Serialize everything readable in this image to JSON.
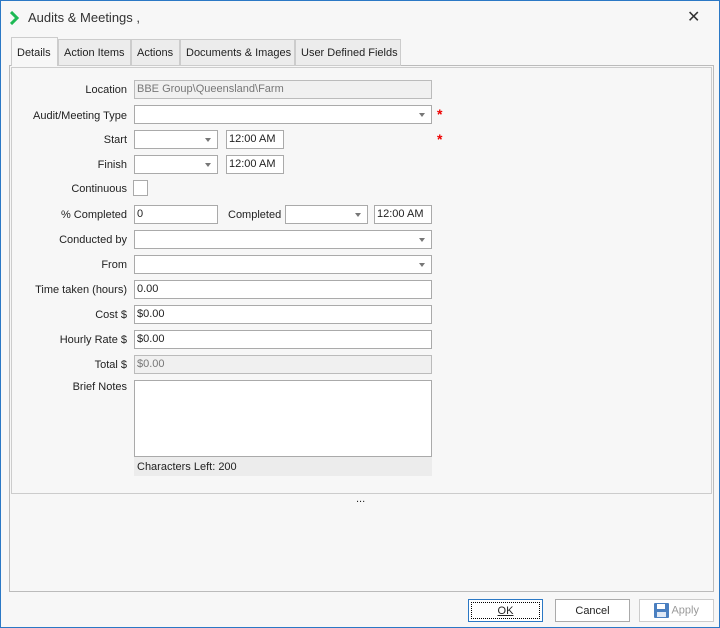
{
  "window": {
    "title": "Audits & Meetings ,",
    "close": "✕"
  },
  "tabs": [
    "Details",
    "Action Items",
    "Actions",
    "Documents & Images",
    "User Defined Fields"
  ],
  "form": {
    "location": {
      "label": "Location",
      "value": "BBE Group\\Queensland\\Farm"
    },
    "type": {
      "label": "Audit/Meeting Type",
      "value": ""
    },
    "start": {
      "label": "Start",
      "date": "",
      "time": "12:00 AM"
    },
    "finish": {
      "label": "Finish",
      "date": "",
      "time": "12:00 AM"
    },
    "continuous": {
      "label": "Continuous",
      "checked": false
    },
    "percent": {
      "label": "% Completed",
      "value": "0"
    },
    "completed": {
      "label": "Completed",
      "date": "",
      "time": "12:00 AM"
    },
    "conducted_by": {
      "label": "Conducted by",
      "value": ""
    },
    "from": {
      "label": "From",
      "value": ""
    },
    "time_taken": {
      "label": "Time taken (hours)",
      "value": "0.00"
    },
    "cost": {
      "label": "Cost $",
      "value": "$0.00"
    },
    "hourly_rate": {
      "label": "Hourly Rate $",
      "value": "$0.00"
    },
    "total": {
      "label": "Total $",
      "value": "$0.00"
    },
    "notes": {
      "label": "Brief Notes",
      "value": "",
      "chars_left": "Characters Left: 200"
    },
    "required_mark": "*"
  },
  "splitter": "...",
  "buttons": {
    "ok": "OK",
    "cancel": "Cancel",
    "apply": "Apply"
  }
}
